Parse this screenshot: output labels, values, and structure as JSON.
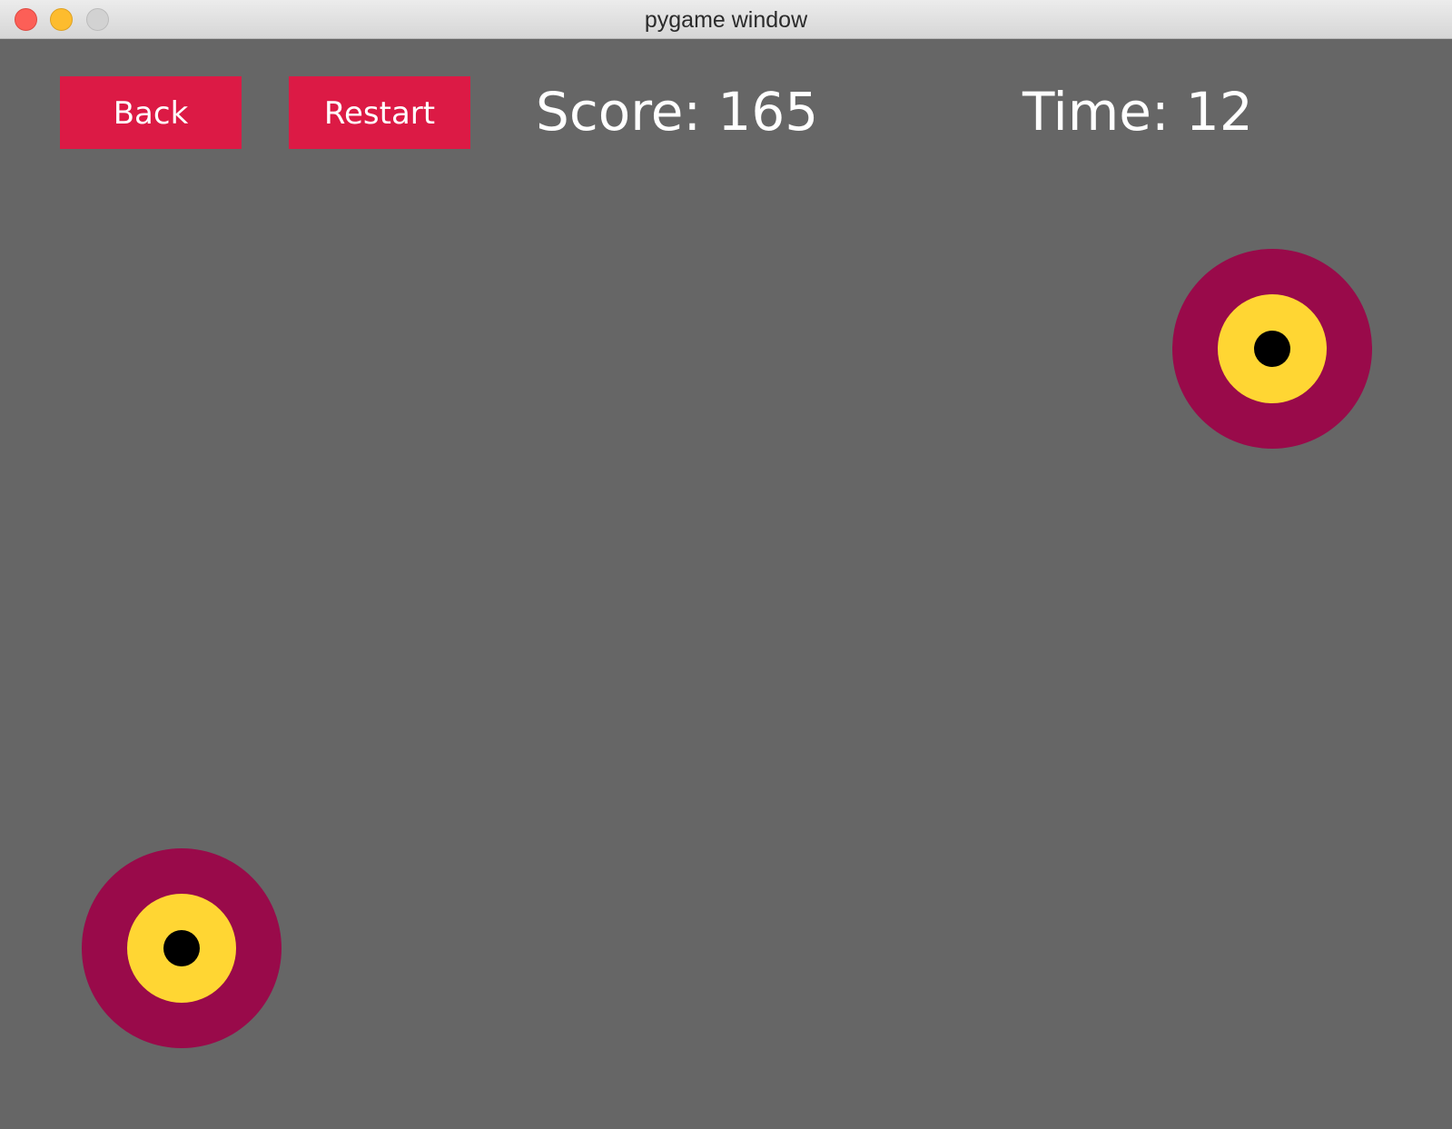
{
  "window": {
    "title": "pygame window"
  },
  "buttons": {
    "back_label": "Back",
    "restart_label": "Restart"
  },
  "hud": {
    "score": "Score: 165",
    "time": "Time: 12"
  },
  "colors": {
    "background": "#666666",
    "button": "#dc1a45",
    "hud_text": "#ffffff",
    "target_outer": "#990a4a",
    "target_middle": "#ffd633",
    "target_center": "#000000"
  },
  "targets": [
    {
      "name": "target-top-right"
    },
    {
      "name": "target-bottom-left"
    }
  ]
}
